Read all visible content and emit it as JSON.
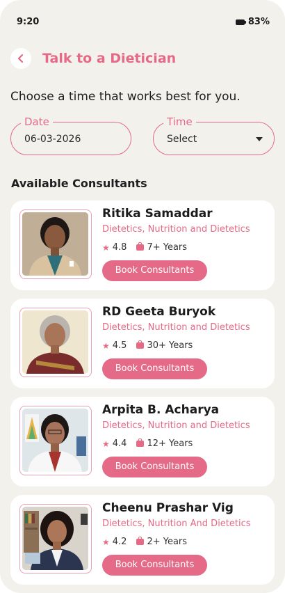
{
  "status": {
    "time": "9:20",
    "battery": "83%"
  },
  "header": {
    "title": "Talk to a Dietician",
    "back_icon": "chevron-left-icon"
  },
  "subtitle": "Choose a time that works best for you.",
  "date_field": {
    "label": "Date",
    "value": "06-03-2026"
  },
  "time_field": {
    "label": "Time",
    "value": "Select"
  },
  "section_title": "Available Consultants",
  "consultants": [
    {
      "name": "Ritika Samaddar",
      "specialty": "Dietetics, Nutrition and Dietetics",
      "rating": "4.8",
      "experience": "7+ Years",
      "button": "Book Consultants"
    },
    {
      "name": "RD Geeta Buryok",
      "specialty": "Dietetics, Nutrition and Dietetics",
      "rating": "4.5",
      "experience": "30+ Years",
      "button": "Book Consultants"
    },
    {
      "name": "Arpita B. Acharya",
      "specialty": "Dietetics, Nutrition and Dietetics",
      "rating": "4.4",
      "experience": "12+ Years",
      "button": "Book Consultants"
    },
    {
      "name": "Cheenu Prashar Vig",
      "specialty": "Dietetics, Nutrition And Dietetics",
      "rating": "4.2",
      "experience": "2+ Years",
      "button": "Book Consultants"
    }
  ],
  "colors": {
    "accent": "#e46a87",
    "background": "#f3f1ec",
    "card": "#ffffff"
  }
}
